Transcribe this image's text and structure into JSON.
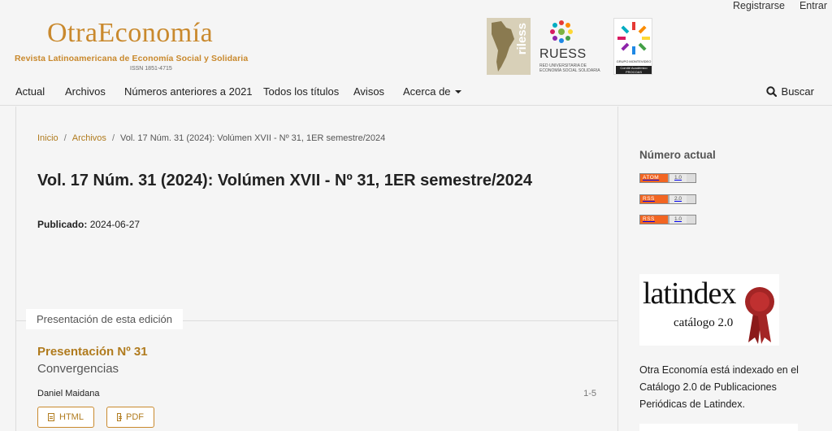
{
  "user_nav": {
    "register": "Registrarse",
    "login": "Entrar"
  },
  "header": {
    "logo_name": "OtraEconomía",
    "logo_subtitle": "Revista Latinoamericana de Economía Social y Solidaria",
    "logo_issn": "ISSN 1851-4715",
    "partners": {
      "riless": "riless",
      "ruess_name": "RUESS",
      "ruess_sub_1": "RED UNIVERSITARIA DE",
      "ruess_sub_2": "ECONOMÍA SOCIAL SOLIDARIA",
      "procoas_1": "GRUPO MONTEVIDEO",
      "procoas_2": "Comité Académico",
      "procoas_3": "PROCOAS"
    }
  },
  "nav": {
    "items": [
      "Actual",
      "Archivos",
      "Números anteriores a 2021",
      "Todos los títulos",
      "Avisos",
      "Acerca de"
    ],
    "search": "Buscar"
  },
  "breadcrumb": {
    "home": "Inicio",
    "archives": "Archivos",
    "current": "Vol. 17 Núm. 31 (2024): Volúmen XVII - Nº 31, 1ER semestre/2024"
  },
  "issue": {
    "title": "Vol. 17 Núm. 31 (2024): Volúmen XVII - Nº 31, 1ER semestre/2024",
    "published_label": "Publicado:",
    "published_date": "2024-06-27"
  },
  "section": {
    "title": "Presentación de esta edición"
  },
  "article": {
    "title": "Presentación Nº 31",
    "subtitle": "Convergencias",
    "author": "Daniel Maidana",
    "pages": "1-5",
    "galleys": [
      "HTML",
      "PDF"
    ]
  },
  "sidebar": {
    "current_issue_title": "Número actual",
    "feeds": [
      {
        "type": "ATOM",
        "version": "1.0"
      },
      {
        "type": "RSS",
        "version": "2.0"
      },
      {
        "type": "RSS",
        "version": "1.0"
      }
    ],
    "latindex_logo": "latindex",
    "latindex_catalog": "catálogo 2.0",
    "indexed_text": "Otra Economía está indexado en el Catálogo 2.0 de Publicaciones Periódicas de Latindex."
  },
  "colors": {
    "accent": "#b07b1e",
    "logo": "#c9892d",
    "feed": "#f26522"
  }
}
